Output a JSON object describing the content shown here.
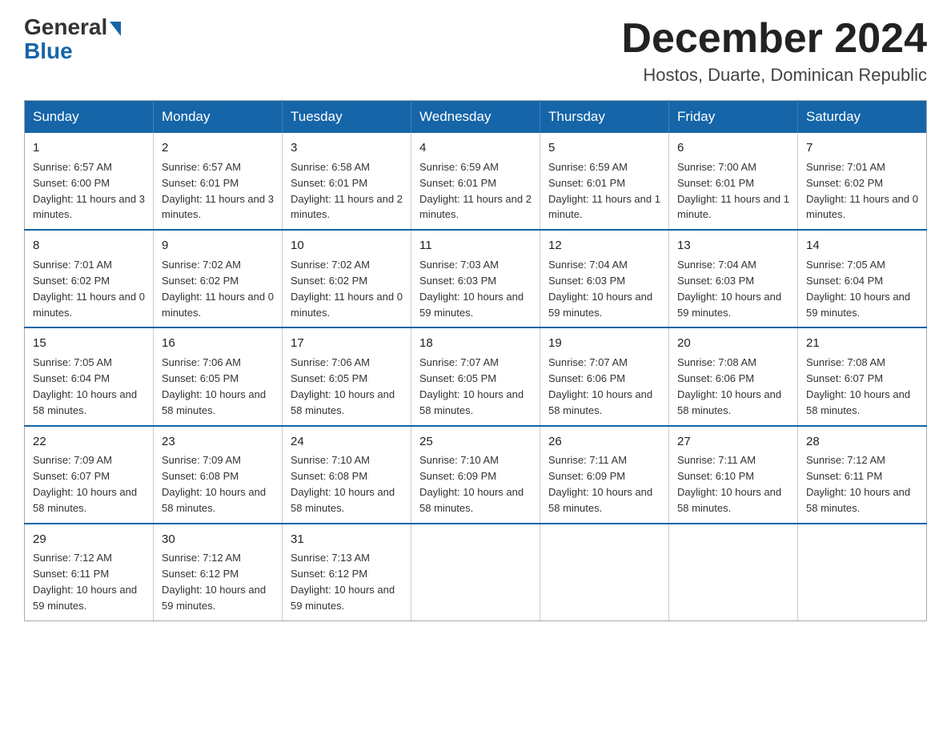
{
  "header": {
    "logo_text": "General",
    "logo_blue": "Blue",
    "month_year": "December 2024",
    "location": "Hostos, Duarte, Dominican Republic"
  },
  "weekdays": [
    "Sunday",
    "Monday",
    "Tuesday",
    "Wednesday",
    "Thursday",
    "Friday",
    "Saturday"
  ],
  "weeks": [
    [
      {
        "day": "1",
        "sunrise": "Sunrise: 6:57 AM",
        "sunset": "Sunset: 6:00 PM",
        "daylight": "Daylight: 11 hours and 3 minutes."
      },
      {
        "day": "2",
        "sunrise": "Sunrise: 6:57 AM",
        "sunset": "Sunset: 6:01 PM",
        "daylight": "Daylight: 11 hours and 3 minutes."
      },
      {
        "day": "3",
        "sunrise": "Sunrise: 6:58 AM",
        "sunset": "Sunset: 6:01 PM",
        "daylight": "Daylight: 11 hours and 2 minutes."
      },
      {
        "day": "4",
        "sunrise": "Sunrise: 6:59 AM",
        "sunset": "Sunset: 6:01 PM",
        "daylight": "Daylight: 11 hours and 2 minutes."
      },
      {
        "day": "5",
        "sunrise": "Sunrise: 6:59 AM",
        "sunset": "Sunset: 6:01 PM",
        "daylight": "Daylight: 11 hours and 1 minute."
      },
      {
        "day": "6",
        "sunrise": "Sunrise: 7:00 AM",
        "sunset": "Sunset: 6:01 PM",
        "daylight": "Daylight: 11 hours and 1 minute."
      },
      {
        "day": "7",
        "sunrise": "Sunrise: 7:01 AM",
        "sunset": "Sunset: 6:02 PM",
        "daylight": "Daylight: 11 hours and 0 minutes."
      }
    ],
    [
      {
        "day": "8",
        "sunrise": "Sunrise: 7:01 AM",
        "sunset": "Sunset: 6:02 PM",
        "daylight": "Daylight: 11 hours and 0 minutes."
      },
      {
        "day": "9",
        "sunrise": "Sunrise: 7:02 AM",
        "sunset": "Sunset: 6:02 PM",
        "daylight": "Daylight: 11 hours and 0 minutes."
      },
      {
        "day": "10",
        "sunrise": "Sunrise: 7:02 AM",
        "sunset": "Sunset: 6:02 PM",
        "daylight": "Daylight: 11 hours and 0 minutes."
      },
      {
        "day": "11",
        "sunrise": "Sunrise: 7:03 AM",
        "sunset": "Sunset: 6:03 PM",
        "daylight": "Daylight: 10 hours and 59 minutes."
      },
      {
        "day": "12",
        "sunrise": "Sunrise: 7:04 AM",
        "sunset": "Sunset: 6:03 PM",
        "daylight": "Daylight: 10 hours and 59 minutes."
      },
      {
        "day": "13",
        "sunrise": "Sunrise: 7:04 AM",
        "sunset": "Sunset: 6:03 PM",
        "daylight": "Daylight: 10 hours and 59 minutes."
      },
      {
        "day": "14",
        "sunrise": "Sunrise: 7:05 AM",
        "sunset": "Sunset: 6:04 PM",
        "daylight": "Daylight: 10 hours and 59 minutes."
      }
    ],
    [
      {
        "day": "15",
        "sunrise": "Sunrise: 7:05 AM",
        "sunset": "Sunset: 6:04 PM",
        "daylight": "Daylight: 10 hours and 58 minutes."
      },
      {
        "day": "16",
        "sunrise": "Sunrise: 7:06 AM",
        "sunset": "Sunset: 6:05 PM",
        "daylight": "Daylight: 10 hours and 58 minutes."
      },
      {
        "day": "17",
        "sunrise": "Sunrise: 7:06 AM",
        "sunset": "Sunset: 6:05 PM",
        "daylight": "Daylight: 10 hours and 58 minutes."
      },
      {
        "day": "18",
        "sunrise": "Sunrise: 7:07 AM",
        "sunset": "Sunset: 6:05 PM",
        "daylight": "Daylight: 10 hours and 58 minutes."
      },
      {
        "day": "19",
        "sunrise": "Sunrise: 7:07 AM",
        "sunset": "Sunset: 6:06 PM",
        "daylight": "Daylight: 10 hours and 58 minutes."
      },
      {
        "day": "20",
        "sunrise": "Sunrise: 7:08 AM",
        "sunset": "Sunset: 6:06 PM",
        "daylight": "Daylight: 10 hours and 58 minutes."
      },
      {
        "day": "21",
        "sunrise": "Sunrise: 7:08 AM",
        "sunset": "Sunset: 6:07 PM",
        "daylight": "Daylight: 10 hours and 58 minutes."
      }
    ],
    [
      {
        "day": "22",
        "sunrise": "Sunrise: 7:09 AM",
        "sunset": "Sunset: 6:07 PM",
        "daylight": "Daylight: 10 hours and 58 minutes."
      },
      {
        "day": "23",
        "sunrise": "Sunrise: 7:09 AM",
        "sunset": "Sunset: 6:08 PM",
        "daylight": "Daylight: 10 hours and 58 minutes."
      },
      {
        "day": "24",
        "sunrise": "Sunrise: 7:10 AM",
        "sunset": "Sunset: 6:08 PM",
        "daylight": "Daylight: 10 hours and 58 minutes."
      },
      {
        "day": "25",
        "sunrise": "Sunrise: 7:10 AM",
        "sunset": "Sunset: 6:09 PM",
        "daylight": "Daylight: 10 hours and 58 minutes."
      },
      {
        "day": "26",
        "sunrise": "Sunrise: 7:11 AM",
        "sunset": "Sunset: 6:09 PM",
        "daylight": "Daylight: 10 hours and 58 minutes."
      },
      {
        "day": "27",
        "sunrise": "Sunrise: 7:11 AM",
        "sunset": "Sunset: 6:10 PM",
        "daylight": "Daylight: 10 hours and 58 minutes."
      },
      {
        "day": "28",
        "sunrise": "Sunrise: 7:12 AM",
        "sunset": "Sunset: 6:11 PM",
        "daylight": "Daylight: 10 hours and 58 minutes."
      }
    ],
    [
      {
        "day": "29",
        "sunrise": "Sunrise: 7:12 AM",
        "sunset": "Sunset: 6:11 PM",
        "daylight": "Daylight: 10 hours and 59 minutes."
      },
      {
        "day": "30",
        "sunrise": "Sunrise: 7:12 AM",
        "sunset": "Sunset: 6:12 PM",
        "daylight": "Daylight: 10 hours and 59 minutes."
      },
      {
        "day": "31",
        "sunrise": "Sunrise: 7:13 AM",
        "sunset": "Sunset: 6:12 PM",
        "daylight": "Daylight: 10 hours and 59 minutes."
      },
      null,
      null,
      null,
      null
    ]
  ]
}
